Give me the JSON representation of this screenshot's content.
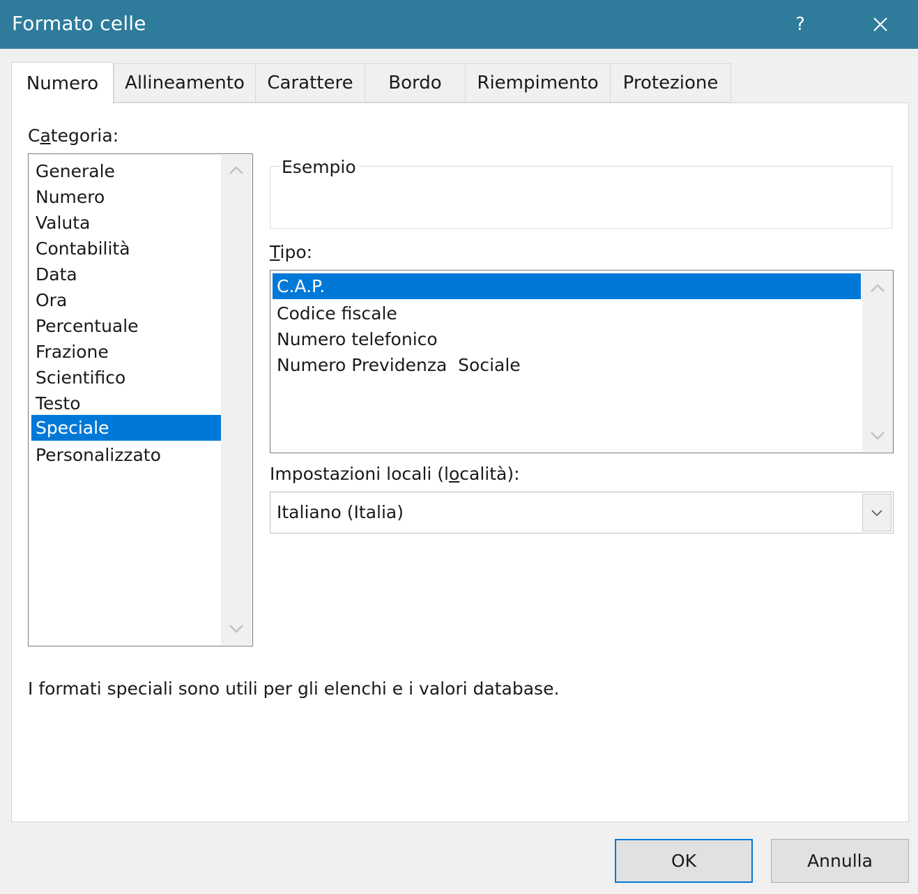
{
  "window": {
    "title": "Formato celle",
    "help_glyph": "?",
    "close_icon": "close-icon"
  },
  "tabs": [
    {
      "label": "Numero",
      "active": true
    },
    {
      "label": "Allineamento",
      "active": false
    },
    {
      "label": "Carattere",
      "active": false
    },
    {
      "label": "Bordo",
      "active": false
    },
    {
      "label": "Riempimento",
      "active": false
    },
    {
      "label": "Protezione",
      "active": false
    }
  ],
  "category": {
    "label_pre": "C",
    "label_acc": "a",
    "label_post": "tegoria:",
    "items": [
      "Generale",
      "Numero",
      "Valuta",
      "Contabilità",
      "Data",
      "Ora",
      "Percentuale",
      "Frazione",
      "Scientifico",
      "Testo",
      "Speciale",
      "Personalizzato"
    ],
    "selected": "Speciale"
  },
  "example": {
    "label": "Esempio",
    "value": ""
  },
  "type": {
    "label_acc": "T",
    "label_post": "ipo:",
    "items": [
      "C.A.P.",
      "Codice fiscale",
      "Numero telefonico",
      "Numero Previdenza  Sociale"
    ],
    "selected": "C.A.P."
  },
  "locale": {
    "label_pre": "Impostazioni locali (l",
    "label_acc": "o",
    "label_post": "calità):",
    "value": "Italiano (Italia)"
  },
  "description": "I formati speciali sono utili per gli elenchi e i valori database.",
  "buttons": {
    "ok": "OK",
    "cancel": "Annulla"
  },
  "colors": {
    "titlebar": "#2e7b9b",
    "selection": "#0078d7"
  }
}
